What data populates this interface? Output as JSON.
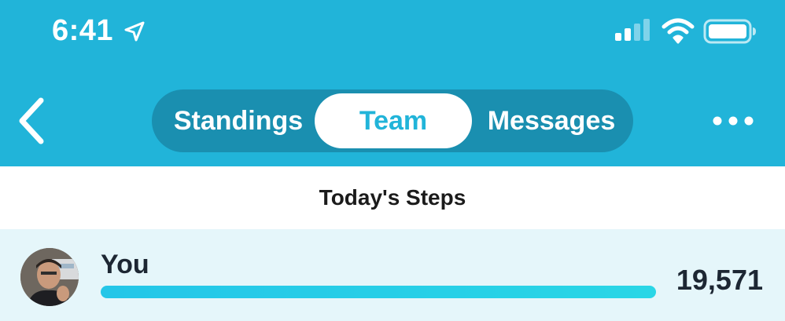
{
  "status_bar": {
    "time": "6:41",
    "icons": [
      "location-arrow-icon",
      "cellular-signal-icon",
      "wifi-icon",
      "battery-icon"
    ]
  },
  "nav": {
    "back_icon": "chevron-left-icon",
    "tabs": [
      {
        "label": "Standings",
        "selected": false
      },
      {
        "label": "Team",
        "selected": true
      },
      {
        "label": "Messages",
        "selected": false
      }
    ],
    "more_icon": "more-dots-icon"
  },
  "section": {
    "title": "Today's Steps"
  },
  "leaderboard": [
    {
      "name": "You",
      "steps": "19,571",
      "progress": 1.0
    }
  ],
  "colors": {
    "header_bg": "#21b4d9",
    "segment_bg": "#1a8fb0",
    "row_bg": "#e5f6fa",
    "bar": "#24c6e8",
    "text_dark": "#1d2733"
  }
}
